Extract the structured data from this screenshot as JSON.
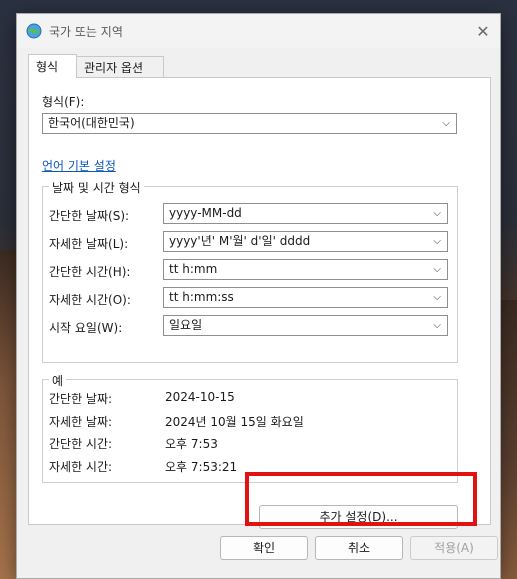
{
  "window": {
    "title": "국가 또는 지역",
    "close_icon": "close-icon"
  },
  "tabs": [
    {
      "label": "형식",
      "active": true
    },
    {
      "label": "관리자 옵션",
      "active": false
    }
  ],
  "format": {
    "label": "형식(F):",
    "value": "한국어(대한민국)"
  },
  "language_link": "언어 기본 설정",
  "datetime": {
    "title": "날짜 및 시간 형식",
    "rows": [
      {
        "label": "간단한 날짜(S):",
        "value": "yyyy-MM-dd"
      },
      {
        "label": "자세한 날짜(L):",
        "value": "yyyy'년' M'월' d'일' dddd"
      },
      {
        "label": "간단한 시간(H):",
        "value": "tt h:mm"
      },
      {
        "label": "자세한 시간(O):",
        "value": "tt h:mm:ss"
      },
      {
        "label": "시작 요일(W):",
        "value": "일요일"
      }
    ]
  },
  "examples": {
    "title": "예",
    "rows": [
      {
        "label": "간단한 날짜:",
        "value": "2024-10-15"
      },
      {
        "label": "자세한 날짜:",
        "value": "2024년 10월 15일 화요일"
      },
      {
        "label": "간단한 시간:",
        "value": "오후 7:53"
      },
      {
        "label": "자세한 시간:",
        "value": "오후 7:53:21"
      }
    ]
  },
  "additional_settings": "추가 설정(D)...",
  "buttons": {
    "ok": "확인",
    "cancel": "취소",
    "apply": "적용(A)"
  },
  "colors": {
    "highlight": "#e01212",
    "link": "#0a58b8"
  }
}
